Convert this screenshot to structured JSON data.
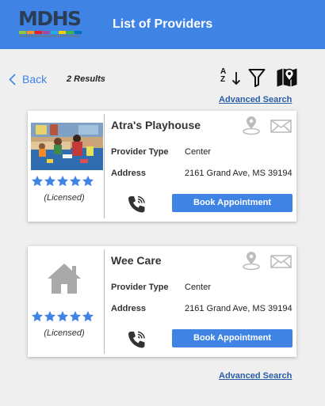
{
  "header": {
    "logo_text": "MDHS",
    "title": "List of Providers",
    "background": "#3f84e5"
  },
  "toolbar": {
    "back_label": "Back",
    "results_text": "2 Results",
    "sort_icon_text": "A\nZ",
    "sort_icon": "sort-az-icon",
    "filter_icon": "filter-icon",
    "map_icon": "map-pin-icon"
  },
  "advanced_search_label": "Advanced Search",
  "providers": [
    {
      "name": "Atra's Playhouse",
      "provider_type_label": "Provider Type",
      "provider_type": "Center",
      "address_label": "Address",
      "address": "2161 Grand Ave, MS 39194",
      "rating": 5,
      "status": "(Licensed)",
      "book_label": "Book Appointment",
      "image": "classroom-photo"
    },
    {
      "name": "Wee Care",
      "provider_type_label": "Provider Type",
      "provider_type": "Center",
      "address_label": "Address",
      "address": "2161 Grand Ave, MS 39194",
      "rating": 5,
      "status": "(Licensed)",
      "book_label": "Book Appointment",
      "image": "home-icon"
    }
  ],
  "colors": {
    "accent": "#3f84e5",
    "star": "#3f84e5",
    "link": "#2a5da6",
    "icon_gray": "#bdbdbd"
  }
}
